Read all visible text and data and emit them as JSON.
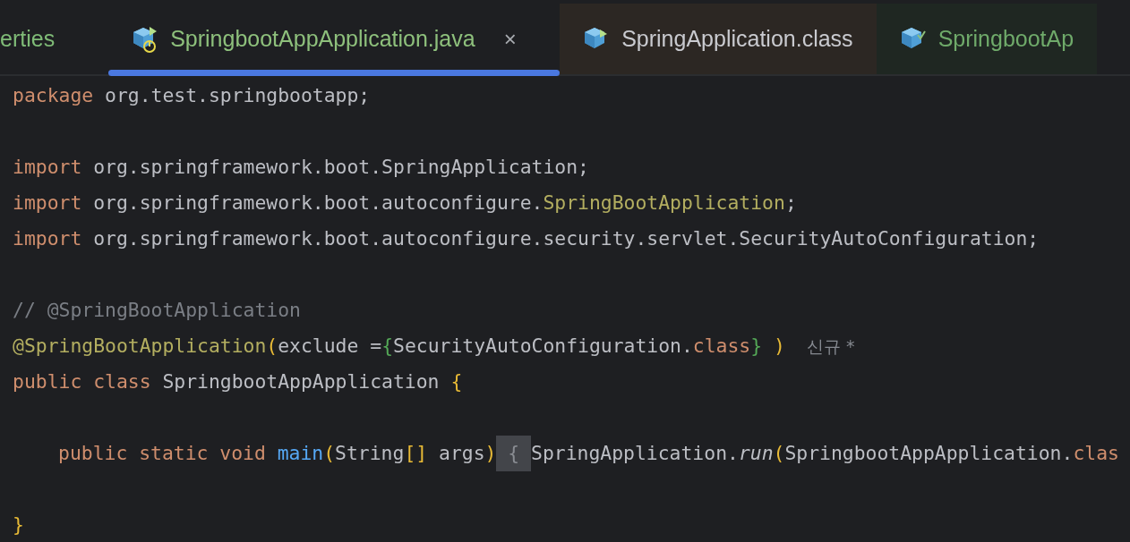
{
  "tabs": [
    {
      "label": "erties",
      "selected": false,
      "kind": "plain"
    },
    {
      "label": "SpringbootAppApplication.java",
      "selected": true,
      "kind": "runnable",
      "close": "×"
    },
    {
      "label": "SpringApplication.class",
      "selected": false,
      "kind": "readonly"
    },
    {
      "label": "SpringbootAp",
      "selected": false,
      "kind": "modified"
    }
  ],
  "editor": {
    "blocks": [
      [
        {
          "tokens": [
            {
              "text": "package",
              "kind": "keyword"
            },
            {
              "text": " org.test.springbootapp;",
              "kind": "plain"
            }
          ]
        }
      ],
      [
        {
          "tokens": [
            {
              "text": "import",
              "kind": "keyword"
            },
            {
              "text": " org.springframework.boot.SpringApplication;",
              "kind": "plain"
            }
          ]
        },
        {
          "tokens": [
            {
              "text": "import",
              "kind": "keyword"
            },
            {
              "text": " org.springframework.boot.autoconfigure.",
              "kind": "plain"
            },
            {
              "text": "SpringBootApplication",
              "kind": "annotation"
            },
            {
              "text": ";",
              "kind": "plain"
            }
          ]
        },
        {
          "tokens": [
            {
              "text": "import",
              "kind": "keyword"
            },
            {
              "text": " org.springframework.boot.autoconfigure.security.servlet.SecurityAutoConfiguration;",
              "kind": "plain"
            }
          ]
        }
      ],
      [
        {
          "tokens": [
            {
              "text": "// @SpringBootApplication",
              "kind": "comment"
            }
          ]
        },
        {
          "tokens": [
            {
              "text": "@SpringBootApplication",
              "kind": "annotation"
            },
            {
              "text": "(",
              "kind": "paren"
            },
            {
              "text": "exclude =",
              "kind": "plain"
            },
            {
              "text": "{",
              "kind": "brace2"
            },
            {
              "text": "SecurityAutoConfiguration.",
              "kind": "plain"
            },
            {
              "text": "class",
              "kind": "keyword"
            },
            {
              "text": "}",
              "kind": "brace2"
            },
            {
              "text": " )",
              "kind": "paren"
            },
            {
              "text": "신규 *",
              "kind": "hint"
            }
          ]
        },
        {
          "tokens": [
            {
              "text": "public class",
              "kind": "keyword"
            },
            {
              "text": " SpringbootAppApplication ",
              "kind": "plain"
            },
            {
              "text": "{",
              "kind": "paren"
            }
          ]
        }
      ],
      [
        {
          "indented": true,
          "tokens": [
            {
              "text": "public static void ",
              "kind": "keyword"
            },
            {
              "text": "main",
              "kind": "method"
            },
            {
              "text": "(",
              "kind": "paren"
            },
            {
              "text": "String",
              "kind": "plain"
            },
            {
              "text": "[]",
              "kind": "paren"
            },
            {
              "text": " args",
              "kind": "plain"
            },
            {
              "text": ")",
              "kind": "paren"
            },
            {
              "text": " { ",
              "kind": "folded"
            },
            {
              "text": "SpringApplication.",
              "kind": "plain"
            },
            {
              "text": "run",
              "kind": "static"
            },
            {
              "text": "(",
              "kind": "paren"
            },
            {
              "text": "SpringbootAppApplication.",
              "kind": "plain"
            },
            {
              "text": "clas",
              "kind": "keyword"
            }
          ]
        }
      ],
      [
        {
          "tokens": [
            {
              "text": "}",
              "kind": "paren"
            }
          ]
        }
      ]
    ]
  }
}
